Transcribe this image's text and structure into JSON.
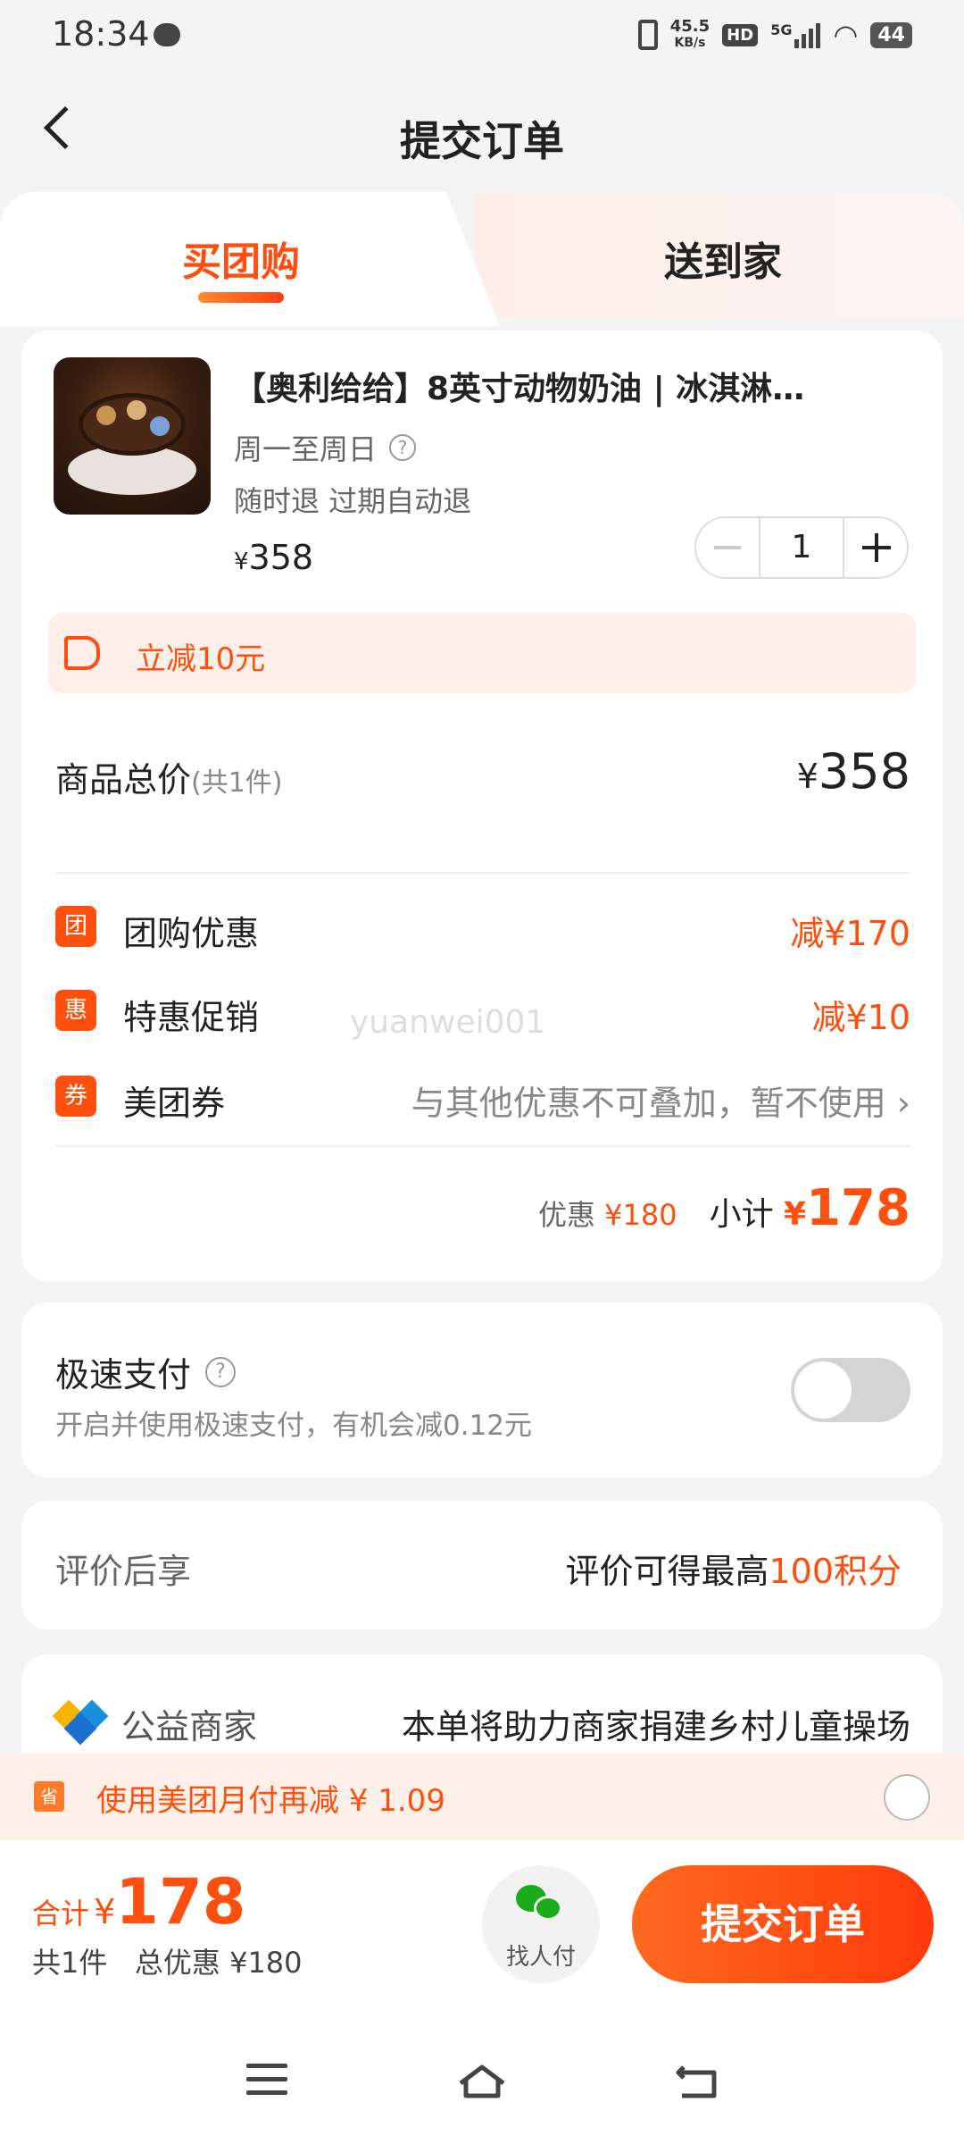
{
  "status_bar": {
    "time": "18:34",
    "speed_top": "45.5",
    "speed_unit": "KB/s",
    "hd": "HD",
    "network": "5G",
    "battery": "44"
  },
  "header": {
    "title": "提交订单"
  },
  "tabs": [
    {
      "label": "买团购",
      "active": true
    },
    {
      "label": "送到家",
      "active": false
    }
  ],
  "product": {
    "title": "【奥利给给】8英寸动物奶油 | 冰淇淋…",
    "valid_days": "周一至周日",
    "tags": "随时退 过期自动退",
    "price_symbol": "¥",
    "price": "358",
    "quantity": "1"
  },
  "promo_banner": {
    "text": "立减10元"
  },
  "summary": {
    "total_label": "商品总价",
    "total_count": "(共1件)",
    "total_symbol": "¥",
    "total_value": "358"
  },
  "discounts": [
    {
      "badge": "团",
      "name": "团购优惠",
      "amount": "减¥170"
    },
    {
      "badge": "惠",
      "name": "特惠促销",
      "amount": "减¥10"
    },
    {
      "badge": "券",
      "name": "美团券",
      "note": "与其他优惠不可叠加，暂不使用 ›"
    }
  ],
  "watermark": "yuanwei001",
  "subtotal": {
    "discount_label": "优惠",
    "discount_value": "¥180",
    "subtotal_label": "小计",
    "subtotal_symbol": "¥",
    "subtotal_value": "178"
  },
  "fast_pay": {
    "title": "极速支付",
    "description": "开启并使用极速支付，有机会减0.12元",
    "enabled": false
  },
  "review": {
    "label": "评价后享",
    "prefix": "评价可得最高",
    "highlight": "100积分"
  },
  "charity": {
    "label": "公益商家",
    "text": "本单将助力商家捐建乡村儿童操场"
  },
  "monthly_pay": {
    "icon_text": "省",
    "text": "使用美团月付再减 ¥ 1.09"
  },
  "bottom_bar": {
    "total_label": "合计",
    "symbol": "¥",
    "total_value": "178",
    "count_text": "共1件",
    "discount_text": "总优惠 ¥180",
    "find_pay_label": "找人付",
    "submit_label": "提交订单"
  },
  "colors": {
    "accent": "#ff4f0f",
    "background": "#f4f4f4",
    "wechat": "#1aad19"
  }
}
